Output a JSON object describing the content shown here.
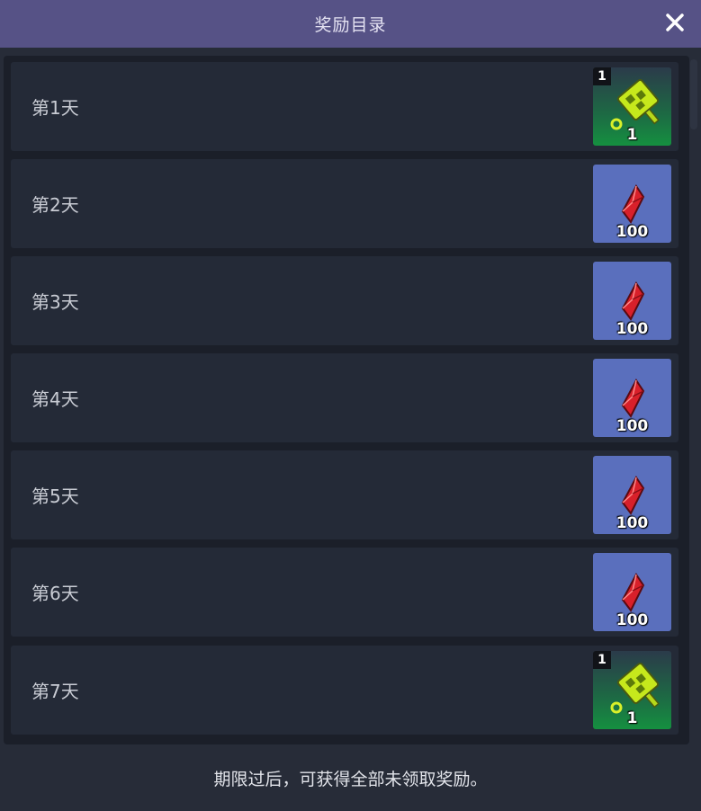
{
  "header": {
    "title": "奖励目录",
    "close_icon": "close-icon"
  },
  "rows": [
    {
      "day_label": "第1天",
      "reward_type": "key-icon",
      "quantity": "1",
      "badge": "1"
    },
    {
      "day_label": "第2天",
      "reward_type": "red-gem-icon",
      "quantity": "100"
    },
    {
      "day_label": "第3天",
      "reward_type": "red-gem-icon",
      "quantity": "100"
    },
    {
      "day_label": "第4天",
      "reward_type": "red-gem-icon",
      "quantity": "100"
    },
    {
      "day_label": "第5天",
      "reward_type": "red-gem-icon",
      "quantity": "100"
    },
    {
      "day_label": "第6天",
      "reward_type": "red-gem-icon",
      "quantity": "100"
    },
    {
      "day_label": "第7天",
      "reward_type": "key-icon",
      "quantity": "1",
      "badge": "1"
    }
  ],
  "footer": {
    "note": "期限过后，可获得全部未领取奖励。"
  },
  "colors": {
    "header_bg": "#565286",
    "gem_tile_bg": "#5a6fbd",
    "key_tile_bg": "#159040",
    "gem_color": "#d8202a",
    "key_color": "#c6e81c"
  }
}
